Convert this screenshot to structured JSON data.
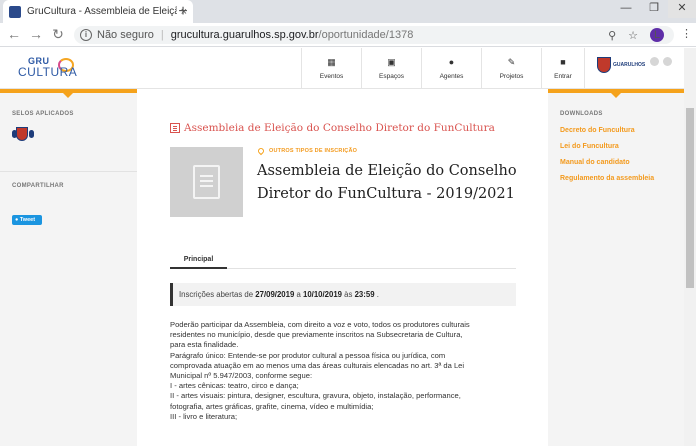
{
  "browser": {
    "tab_title": "GruCultura - Assembleia de Eleição",
    "tab_close": "×",
    "new_tab": "+",
    "window_controls": [
      "—",
      "❐",
      "✕"
    ],
    "nav": {
      "back": "←",
      "forward": "→",
      "reload": "↻"
    },
    "security_label": "Não seguro",
    "url_host": "grucultura.guarulhos.sp.gov.br",
    "url_path": "/oportunidade/1378",
    "profile_initial": "L"
  },
  "header": {
    "logo_top": "GRU",
    "logo_bottom": "CULTURA",
    "nav": [
      {
        "label": "Eventos",
        "icon": "calendar-icon"
      },
      {
        "label": "Espaços",
        "icon": "building-icon"
      },
      {
        "label": "Agentes",
        "icon": "person-icon"
      },
      {
        "label": "Projetos",
        "icon": "edit-icon"
      },
      {
        "label": "Entrar",
        "icon": "lock-icon"
      }
    ],
    "brasao_text": "GUARULHOS"
  },
  "left_sidebar": {
    "selos_heading": "SELOS APLICADOS",
    "compartilhar_heading": "COMPARTILHAR",
    "tweet_label": "Tweet"
  },
  "right_sidebar": {
    "downloads_heading": "DOWNLOADS",
    "links": [
      "Decreto do Funcultura",
      "Lei do Funcultura",
      "Manual do candidato",
      "Regulamento da assembleia"
    ]
  },
  "main": {
    "breadcrumb": "Assembleia de Eleição do Conselho Diretor do FunCultura",
    "type_label": "OUTROS TIPOS DE INSCRIÇÃO",
    "title": "Assembleia de Eleição do Conselho Diretor do FunCultura - 2019/2021",
    "tab_principal": "Principal",
    "inscricoes": {
      "prefix": "Inscrições abertas de ",
      "start": "27/09/2019",
      "mid1": " a ",
      "end": "10/10/2019",
      "mid2": " às ",
      "time": "23:59",
      "suffix": " ."
    },
    "body_lines": [
      "Poderão participar da Assembleia, com direito a voz e voto, todos os produtores culturais",
      "residentes no município, desde que previamente inscritos na Subsecretaria de Cultura,",
      "para esta finalidade.",
      "Parágrafo único: Entende-se por produtor cultural a pessoa física ou jurídica, com",
      "comprovada atuação em ao menos uma das áreas culturais elencadas no art. 3ª da Lei",
      "Municipal nº 5.947/2003, conforme segue:",
      "I - artes cênicas: teatro, circo e dança;",
      "II - artes visuais: pintura, designer, escultura, gravura, objeto, instalação, performance,",
      "fotografia, artes gráficas, grafite, cinema, vídeo e multimídia;",
      "III - livro e literatura;"
    ]
  },
  "colors": {
    "accent_orange": "#f5a21b",
    "link_orange": "#f39a1d",
    "breadcrumb_red": "#d9534f",
    "sidebar_bg": "#f4f4f4"
  }
}
